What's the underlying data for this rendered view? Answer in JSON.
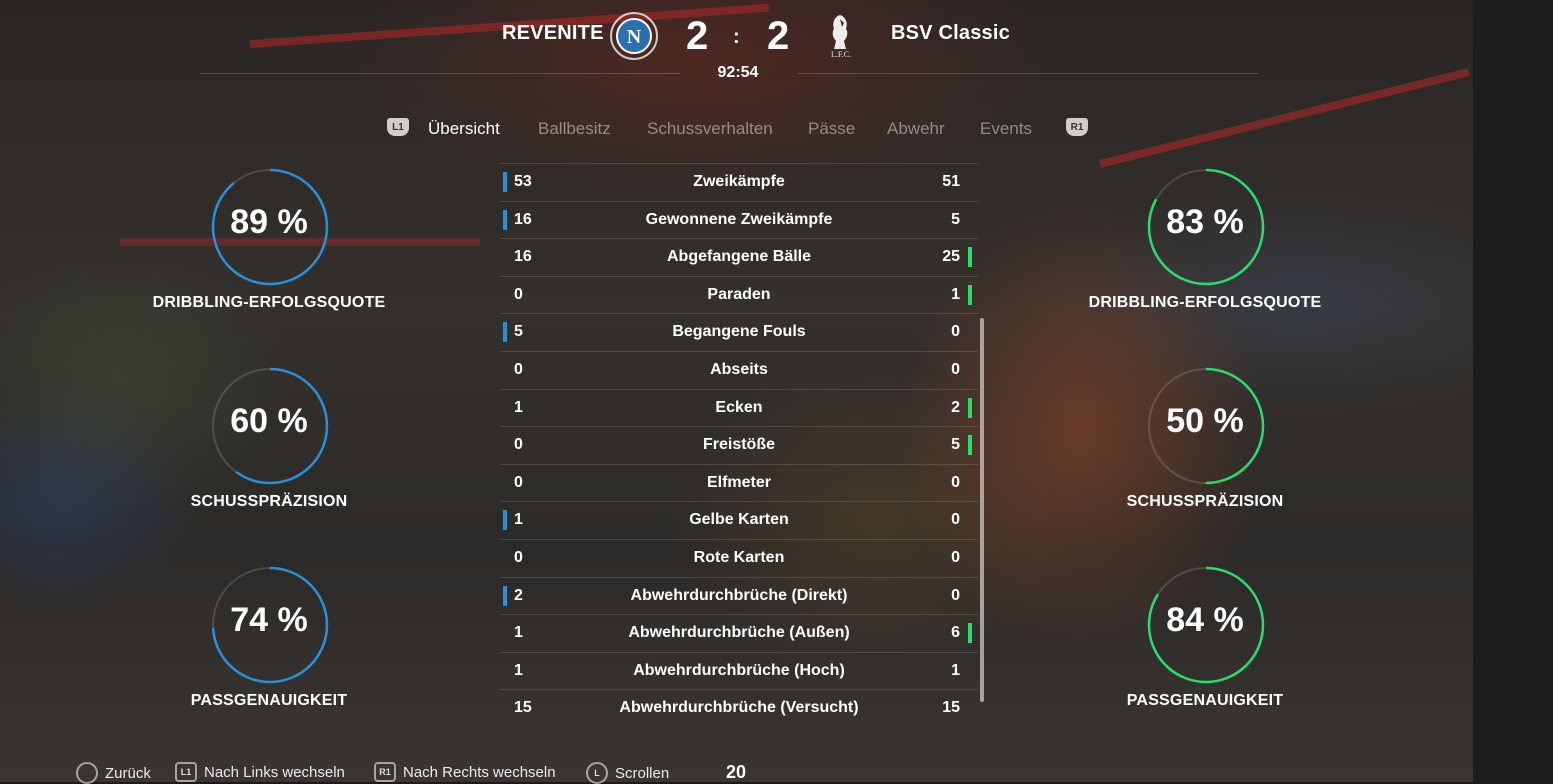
{
  "match": {
    "home_team": "REVENITE",
    "away_team": "BSV Classic",
    "home_score": "2",
    "away_score": "2",
    "separator": ":",
    "clock": "92:54",
    "home_crest_icon": "napoli-crest-icon",
    "away_crest_icon": "liverpool-crest-icon",
    "away_crest_text": "L.F.C."
  },
  "tabs": {
    "left_button": "L1",
    "right_button": "R1",
    "items": [
      "Übersicht",
      "Ballbesitz",
      "Schussverhalten",
      "Pässe",
      "Abwehr",
      "Events"
    ],
    "active": "Übersicht"
  },
  "stats": [
    {
      "label": "Zweikämpfe",
      "home": "53",
      "away": "51",
      "lead": "home"
    },
    {
      "label": "Gewonnene Zweikämpfe",
      "home": "16",
      "away": "5",
      "lead": "home"
    },
    {
      "label": "Abgefangene Bälle",
      "home": "16",
      "away": "25",
      "lead": "away"
    },
    {
      "label": "Paraden",
      "home": "0",
      "away": "1",
      "lead": "away"
    },
    {
      "label": "Begangene Fouls",
      "home": "5",
      "away": "0",
      "lead": "home"
    },
    {
      "label": "Abseits",
      "home": "0",
      "away": "0",
      "lead": "none"
    },
    {
      "label": "Ecken",
      "home": "1",
      "away": "2",
      "lead": "away"
    },
    {
      "label": "Freistöße",
      "home": "0",
      "away": "5",
      "lead": "away"
    },
    {
      "label": "Elfmeter",
      "home": "0",
      "away": "0",
      "lead": "none"
    },
    {
      "label": "Gelbe Karten",
      "home": "1",
      "away": "0",
      "lead": "home"
    },
    {
      "label": "Rote Karten",
      "home": "0",
      "away": "0",
      "lead": "none"
    },
    {
      "label": "Abwehrdurchbrüche (Direkt)",
      "home": "2",
      "away": "0",
      "lead": "home"
    },
    {
      "label": "Abwehrdurchbrüche (Außen)",
      "home": "1",
      "away": "6",
      "lead": "away"
    },
    {
      "label": "Abwehrdurchbrüche (Hoch)",
      "home": "1",
      "away": "1",
      "lead": "none"
    },
    {
      "label": "Abwehrdurchbrüche (Versucht)",
      "home": "15",
      "away": "15",
      "lead": "none"
    }
  ],
  "gauges": {
    "home": [
      {
        "value": 89,
        "text": "89 %",
        "label": "DRIBBLING-ERFOLGSQUOTE"
      },
      {
        "value": 60,
        "text": "60 %",
        "label": "SCHUSSPRÄZISION"
      },
      {
        "value": 74,
        "text": "74 %",
        "label": "PASSGENAUIGKEIT"
      }
    ],
    "away": [
      {
        "value": 83,
        "text": "83 %",
        "label": "DRIBBLING-ERFOLGSQUOTE"
      },
      {
        "value": 50,
        "text": "50 %",
        "label": "SCHUSSPRÄZISION"
      },
      {
        "value": 84,
        "text": "84 %",
        "label": "PASSGENAUIGKEIT"
      }
    ]
  },
  "colors": {
    "home_accent": "#2b8fd8",
    "away_accent": "#2bdc6c"
  },
  "footer": {
    "back_label": "Zurück",
    "left_label": "Nach Links wechseln",
    "right_label": "Nach Rechts wechseln",
    "scroll_label": "Scrollen",
    "back_icon": "circle-button-icon",
    "left_icon_text": "L1",
    "right_icon_text": "R1",
    "scroll_icon_text": "L",
    "counter": "20"
  }
}
